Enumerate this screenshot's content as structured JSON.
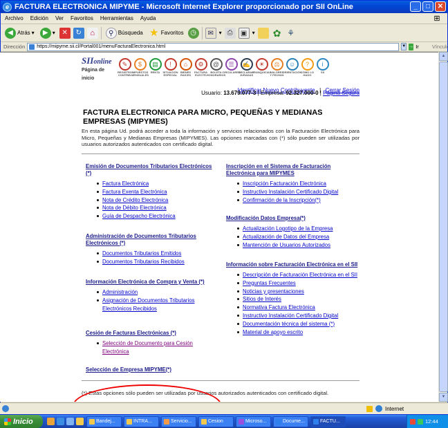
{
  "window": {
    "title": "FACTURA ELECTRONICA MIPYME - Microsoft Internet Explorer proporcionado por SII OnLine",
    "min": "_",
    "max": "□",
    "close": "✕"
  },
  "menu": [
    "Archivo",
    "Edición",
    "Ver",
    "Favoritos",
    "Herramientas",
    "Ayuda"
  ],
  "toolbar": {
    "back": "Atrás",
    "search": "Búsqueda",
    "favorites": "Favoritos"
  },
  "address": {
    "label": "Dirección",
    "url": "https://mipyme.sii.cl/Portal001/menuFacturaElectronica.html",
    "go": "Ir",
    "links": "Vínculos"
  },
  "banner": {
    "logo": "SII",
    "logo_suffix": "online",
    "home": "Página de inicio",
    "icons": [
      {
        "name": "registro-contribuyentes",
        "label": "REGISTRO CONTRIB.",
        "color": "#c0392b",
        "glyph": "✎"
      },
      {
        "name": "impuestos-mensuales",
        "label": "IMPUESTOS MENSUALES",
        "color": "#e67e22",
        "glyph": "$"
      },
      {
        "name": "renta",
        "label": "RENTA",
        "color": "#1f9a3a",
        "glyph": "▤"
      },
      {
        "name": "situacion-especial",
        "label": "SITUACIÓN ESPECIAL",
        "color": "#c0392b",
        "glyph": "!"
      },
      {
        "name": "bienes-raices",
        "label": "BIENES RAÍCES",
        "color": "#d35400",
        "glyph": "⌂"
      },
      {
        "name": "factura-electronica",
        "label": "FACTURA ELECTR.",
        "color": "#c0392b",
        "glyph": "⚙"
      },
      {
        "name": "boleta-honorarios",
        "label": "BOLETA HONORARIOS",
        "color": "#555555",
        "glyph": "@"
      },
      {
        "name": "circulares",
        "label": "CIRCULARES",
        "color": "#8e44ad",
        "glyph": "☰"
      },
      {
        "name": "declaraciones-juradas",
        "label": "DECLARAC. JURADAS",
        "color": "#2c3e50",
        "glyph": "✍"
      },
      {
        "name": "ley-franquicias",
        "label": "FRANQUICIAS",
        "color": "#c0392b",
        "glyph": "☀"
      },
      {
        "name": "valores-fechas",
        "label": "VALORES Y FECHAS",
        "color": "#e67e22",
        "glyph": "⚖"
      },
      {
        "name": "orientacion-tributaria",
        "label": "ORIENTACIÓN",
        "color": "#2980b9",
        "glyph": "☺"
      },
      {
        "name": "como-lo-hago",
        "label": "CÓMO LO HAGO",
        "color": "#f39c12",
        "glyph": "?"
      },
      {
        "name": "sitio-sii",
        "label": "SII",
        "color": "#2e86c1",
        "glyph": "i"
      }
    ]
  },
  "user": {
    "link_new": "Identificar Nuevo Contribuyente",
    "link_close": "Cerrar Sesión",
    "user_label": "Usuario:",
    "user_value": "13.679.077-3",
    "company_label": "| Empresa:",
    "company_value": "92.327.000-0",
    "secure_link": "Página Segura",
    "pipe": "|"
  },
  "page": {
    "title": "FACTURA ELECTRONICA PARA MICRO, PEQUEÑAS Y MEDIANAS EMPRESAS (MIPYMES)",
    "intro": "En esta página Ud. podrá acceder a toda la información y servicios relacionados con la Facturación Electrónica para Micro, Pequeñas y Medianas Empresas (MIPYMES). Las opciones marcadas con (*) sólo pueden ser utilizadas por usuarios autorizados autenticados con certificado digital.",
    "footnote": "(*) Estas opciones sólo pueden ser utilizadas por usuarios autorizados autenticados con certificado digital."
  },
  "left": [
    {
      "title": "Emisión de Documentos Tributarios Electrónicos (*)",
      "items": [
        "Factura Electrónica",
        "Factura Exenta Electrónica",
        "Nota de Crédito Electrónica",
        "Nota de Débito Electrónica",
        "Guía de Despacho Electrónica"
      ]
    },
    {
      "title": "Administración de Documentos Tributarios Electrónicos (*)",
      "items": [
        "Documentos Tributarios Emitidos",
        "Documentos Tributarios Recibidos"
      ]
    },
    {
      "title": "Información Electrónica de Compra y Venta (*)",
      "items": [
        "Administración",
        "Asignación de Documentos Tributarios Electrónicos Recibidos"
      ]
    },
    {
      "title": "Cesión de Facturas Electrónicas (*)",
      "items": [
        "Selección de Documento para Cesión Electrónica"
      ]
    },
    {
      "title": "Selección de Empresa MIPYME(*)",
      "items": []
    }
  ],
  "right": [
    {
      "title": "Inscripción en el Sistema de Facturación Electrónica para MIPYMES",
      "items": [
        "Inscripción Facturación Electrónica",
        "Instructivo Instalación Certificado Digital",
        "Confirmación de la Inscripción(*)"
      ]
    },
    {
      "title": "Modificación Datos Empresa(*)",
      "items": [
        "Actualización Logotipo de la Empresa",
        "Actualización de Datos del Empresa",
        "Mantención de Usuarios Autorizados"
      ]
    },
    {
      "title": "Información sobre Facturación Electrónica en el SII",
      "items": [
        "Descripción de Facturación Electrónica en el SII",
        "Preguntas Frecuentes",
        "Noticias y presentaciones",
        "Sitios de Interés",
        "Normativa Factura Electrónica",
        "Instructivo Instalación Certificado Digital",
        "Documentación técnica del sistema (*)",
        "Material de apoyo escrito"
      ]
    }
  ],
  "status": {
    "zone": "Internet"
  },
  "taskbar": {
    "start": "Inicio",
    "tasks": [
      {
        "label": "Bandej...",
        "color": "#f2c94c"
      },
      {
        "label": "INTRA...",
        "color": "#f2c94c"
      },
      {
        "label": "Servicio...",
        "color": "#f2994a"
      },
      {
        "label": "Cesion",
        "color": "#f2c94c"
      },
      {
        "label": "Microso...",
        "color": "#9b51e0"
      },
      {
        "label": "Docume...",
        "color": "#2f80ed"
      },
      {
        "label": "FACTU...",
        "color": "#2f80ed"
      }
    ],
    "clock": "12:44"
  }
}
